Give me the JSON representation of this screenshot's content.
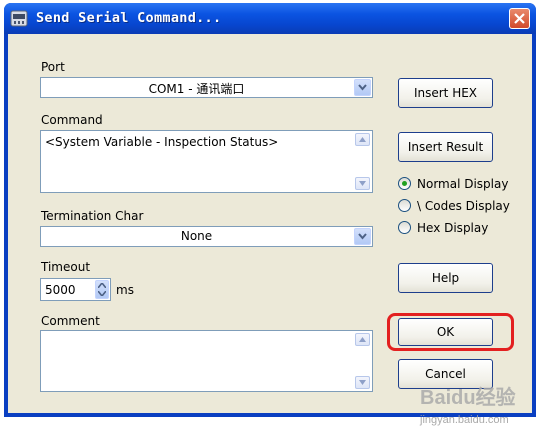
{
  "window": {
    "title": "Send Serial Command...",
    "icons": {
      "app": "serial-port-icon",
      "close": "close-icon"
    }
  },
  "form": {
    "port_label": "Port",
    "port_value": "COM1 - 通讯端口",
    "command_label": "Command",
    "command_value": "<System Variable - Inspection Status>",
    "termination_label": "Termination Char",
    "termination_value": "None",
    "timeout_label": "Timeout",
    "timeout_value": "5000",
    "timeout_unit": "ms",
    "comment_label": "Comment",
    "comment_value": ""
  },
  "buttons": {
    "insert_hex": "Insert HEX",
    "insert_result": "Insert Result",
    "help": "Help",
    "ok": "OK",
    "cancel": "Cancel"
  },
  "display_mode": {
    "options": [
      "Normal Display",
      "\\ Codes Display",
      "Hex Display"
    ],
    "selected": "Normal Display"
  },
  "watermark": {
    "logo": "Baidu",
    "text": "经验",
    "url": "jingyan.baidu.com"
  },
  "colors": {
    "highlight": "#e32020",
    "title_bar": "#0b54e2",
    "dialog_bg": "#ece9d8"
  }
}
